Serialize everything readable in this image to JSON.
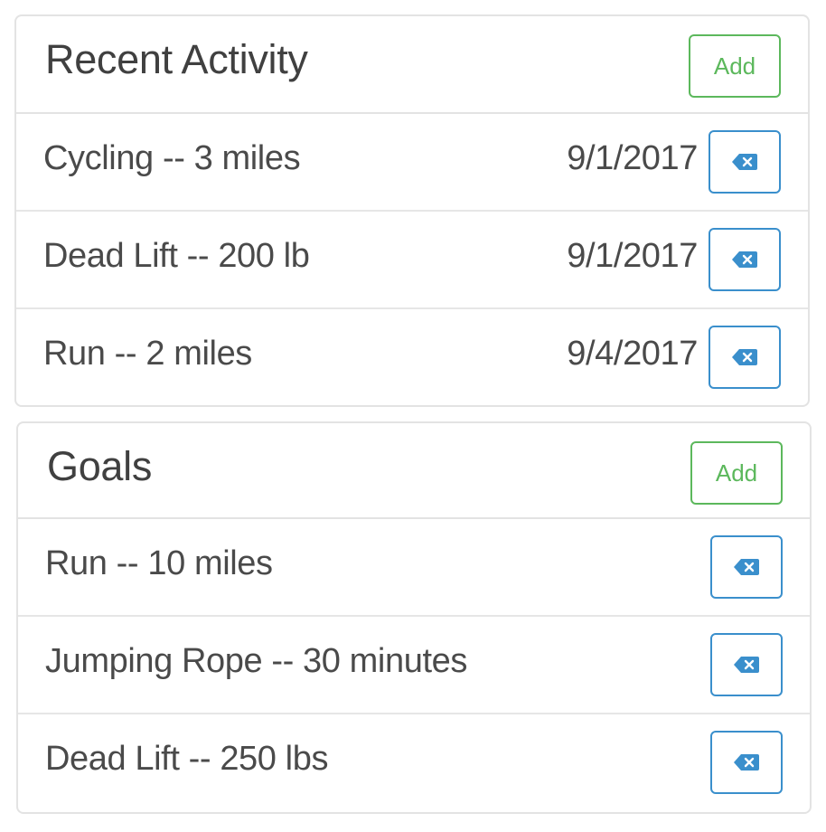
{
  "activity": {
    "title": "Recent Activity",
    "add_label": "Add",
    "items": [
      {
        "label": "Cycling -- 3 miles",
        "date": "9/1/2017",
        "icon": "backspace-icon"
      },
      {
        "label": "Dead Lift -- 200 lb",
        "date": "9/1/2017",
        "icon": "backspace-icon"
      },
      {
        "label": "Run -- 2 miles",
        "date": "9/4/2017",
        "icon": "backspace-icon"
      }
    ]
  },
  "goals": {
    "title": "Goals",
    "add_label": "Add",
    "items": [
      {
        "label": "Run -- 10 miles",
        "icon": "backspace-icon"
      },
      {
        "label": "Jumping Rope -- 30 minutes",
        "icon": "backspace-icon"
      },
      {
        "label": "Dead Lift -- 250 lbs",
        "icon": "backspace-icon"
      }
    ]
  },
  "colors": {
    "add_button": "#5cb85c",
    "delete_button": "#3a8fcc",
    "text": "#4a4a4a",
    "border": "#e3e3e3"
  }
}
